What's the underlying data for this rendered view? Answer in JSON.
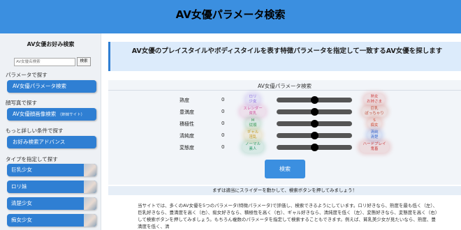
{
  "header": {
    "title": "AV女優パラメータ検索"
  },
  "sidebar": {
    "title": "AV女優お好み検索",
    "search_placeholder": "AV女優名検索",
    "search_button": "検索",
    "section_param": "パラメータで探す",
    "btn_param": "AV女優パラメータ検索",
    "section_face": "顔写真で探す",
    "btn_face": "AV女優顔画像検索",
    "btn_face_note": "（姉妹サイト）",
    "section_detail": "もっと詳しい条件で探す",
    "btn_detail": "お好み検索アドバンス",
    "section_type": "タイプを指定して探す",
    "types": [
      "巨乳少女",
      "ロリ妹",
      "清楚少女",
      "痴女少女"
    ]
  },
  "main": {
    "lead": "AV女優のプレイスタイルやボディスタイルを表す特徴パラメータを指定して一致するAV女優を探します",
    "panel_title": "AV女優パラメータ検索",
    "params": [
      {
        "label": "熟度",
        "value": "0",
        "left": "ロリ\n少女",
        "right": "熟女\nお姉さま",
        "level": 0.5,
        "left_color": "#8a6be0",
        "right_color": "#d04a4a"
      },
      {
        "label": "豊満度",
        "value": "0",
        "left": "スレンダー\n貧乳",
        "right": "巨乳\nぽっちゃり",
        "level": 0.5,
        "left_color": "#d05aa0",
        "right_color": "#c0503c"
      },
      {
        "label": "積極性",
        "value": "0",
        "left": "M\n従順",
        "right": "S\n痴女",
        "level": 0.5,
        "left_color": "#3c9a5a",
        "right_color": "#d0503a"
      },
      {
        "label": "清純度",
        "value": "0",
        "left": "ギャル\n淫乱",
        "right": "清純\n清楚",
        "level": 0.5,
        "left_color": "#c89a20",
        "right_color": "#3a6ad0"
      },
      {
        "label": "変態度",
        "value": "0",
        "left": "ノーマル\n素人",
        "right": "ハードプレイ\n鬼畜",
        "level": 0.5,
        "left_color": "#2f9a6a",
        "right_color": "#c83a3a"
      }
    ],
    "search_button": "検索",
    "hint": "まずは適当にスライダーを動かして、検索ボタンを押してみましょう！",
    "desc": "当サイトでは、多くのAV女優を5つのパラメータ(特徴パラメータ)で評価し、検索できるようにしています。ロリ好きなら、熟度を最も低く（左）、巨乳好きなら、豊満度を高く（右）、痴女好きなら、積極性を高く（右）、ギャル好きなら、清純度を低く（左）、変態好きなら、変態度を高く（右）して検索ボタンを押してみましょう。もちろん複数のパラメータを指定して検索することもできます。例えば、貧乳美少女が見たいなら、熟度、豊満度を低く、清"
  },
  "colors": {
    "header": "#3b8fe0",
    "accent": "#2f7fd3",
    "lead_bg": "#dcebfb",
    "panel_bg": "#f2f5f9"
  }
}
